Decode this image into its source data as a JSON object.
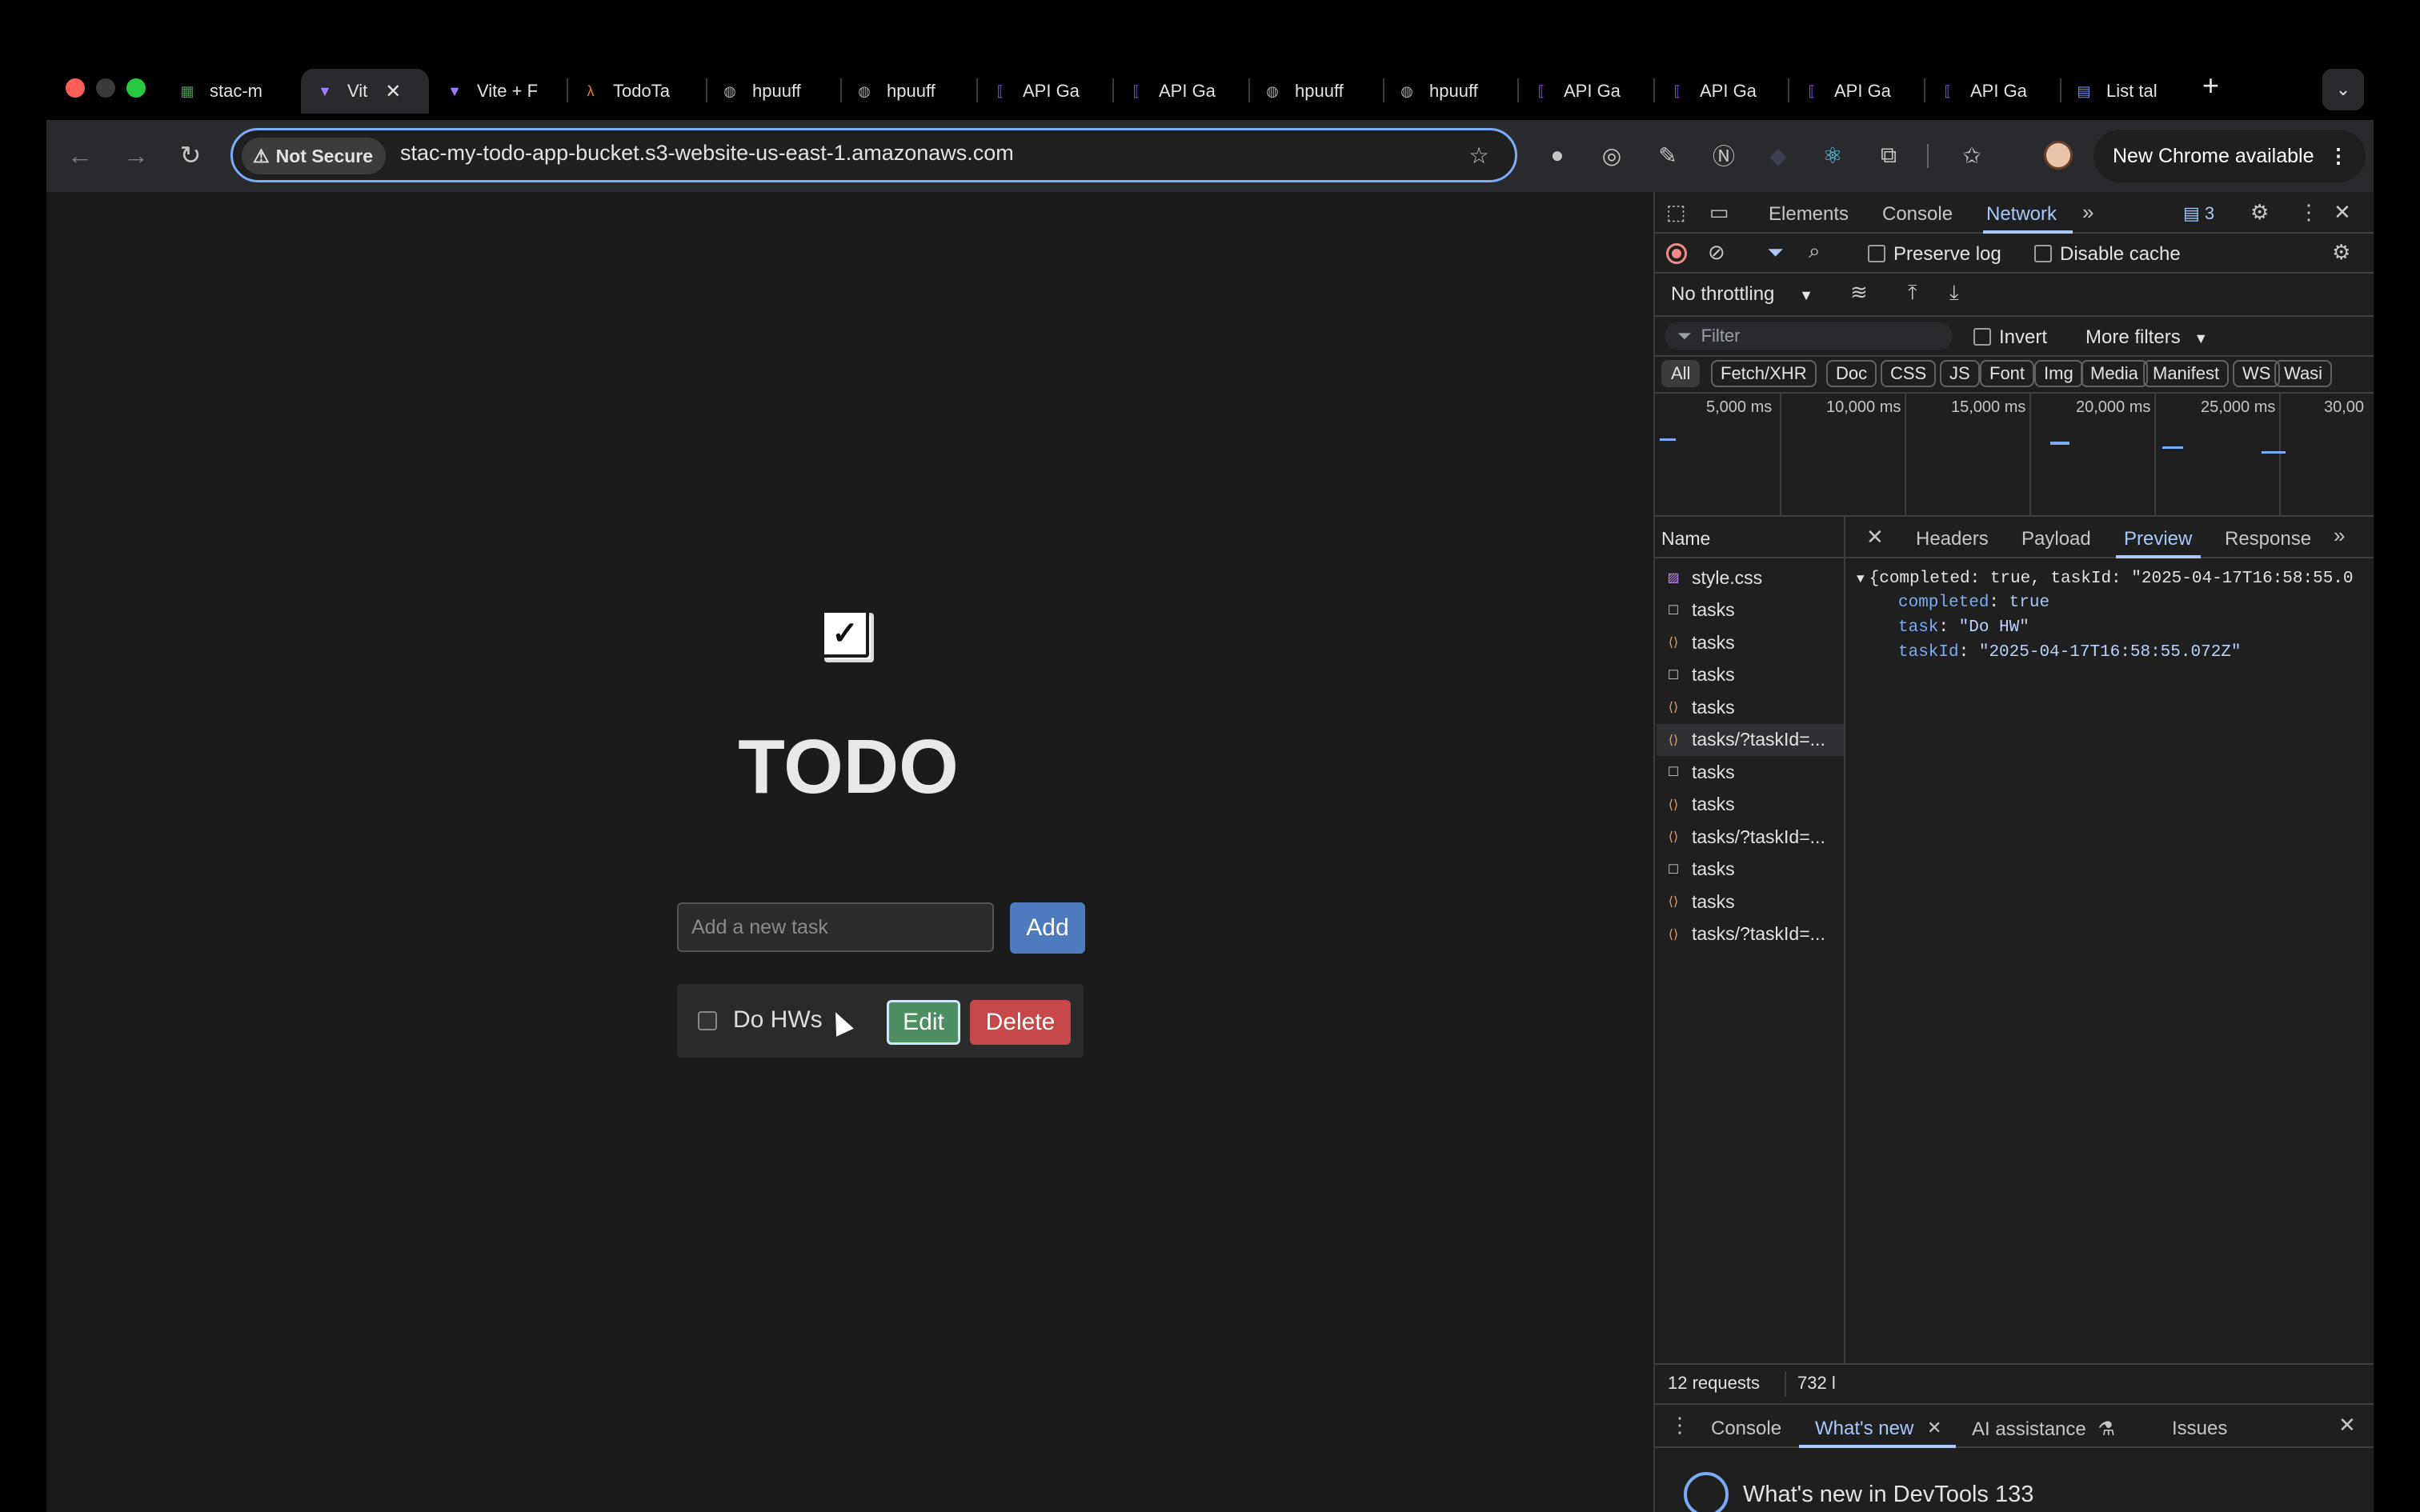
{
  "window": {
    "traffic_lights": [
      "#ff5f57",
      "#3a3a3a",
      "#28c840"
    ]
  },
  "tabs": [
    {
      "label": "stac-m",
      "icon": "sheet-icon",
      "icon_color": "#4c9a52"
    },
    {
      "label": "Vit",
      "icon": "vite-icon",
      "icon_color": "#9d7cff",
      "active": true
    },
    {
      "label": "Vite + F",
      "icon": "vite-icon",
      "icon_color": "#9d7cff"
    },
    {
      "label": "TodoTa",
      "icon": "aws-lambda-icon",
      "icon_color": "#e8841b"
    },
    {
      "label": "hpuuff",
      "icon": "globe-icon",
      "icon_color": "#aaaaaa"
    },
    {
      "label": "hpuuff",
      "icon": "globe-icon",
      "icon_color": "#aaaaaa"
    },
    {
      "label": "API Ga",
      "icon": "api-gateway-icon",
      "icon_color": "#8c4fff"
    },
    {
      "label": "API Ga",
      "icon": "api-gateway-icon",
      "icon_color": "#8c4fff"
    },
    {
      "label": "hpuuff",
      "icon": "globe-icon",
      "icon_color": "#aaaaaa"
    },
    {
      "label": "hpuuff",
      "icon": "globe-icon",
      "icon_color": "#aaaaaa"
    },
    {
      "label": "API Ga",
      "icon": "api-gateway-icon",
      "icon_color": "#8c4fff"
    },
    {
      "label": "API Ga",
      "icon": "api-gateway-icon",
      "icon_color": "#8c4fff"
    },
    {
      "label": "API Ga",
      "icon": "api-gateway-icon",
      "icon_color": "#8c4fff"
    },
    {
      "label": "API Ga",
      "icon": "api-gateway-icon",
      "icon_color": "#8c4fff"
    },
    {
      "label": "List tal",
      "icon": "docs-icon",
      "icon_color": "#6b8cff"
    }
  ],
  "toolbar": {
    "not_secure": "Not Secure",
    "url": "stac-my-todo-app-bucket.s3-website-us-east-1.amazonaws.com",
    "new_chrome": "New Chrome available"
  },
  "app": {
    "title": "TODO",
    "input_placeholder": "Add a new task",
    "add_label": "Add",
    "task": {
      "text": "Do HWs",
      "completed": false
    },
    "edit_label": "Edit",
    "delete_label": "Delete"
  },
  "devtools": {
    "tabs": [
      "Elements",
      "Console",
      "Network"
    ],
    "active_tab": "Network",
    "issues_count": "3",
    "preserve_log": "Preserve log",
    "disable_cache": "Disable cache",
    "throttling": "No throttling",
    "filter_placeholder": "Filter",
    "invert": "Invert",
    "more_filters": "More filters",
    "type_filters": [
      "All",
      "Fetch/XHR",
      "Doc",
      "CSS",
      "JS",
      "Font",
      "Img",
      "Media",
      "Manifest",
      "WS",
      "Wasi"
    ],
    "timeline_labels": [
      "5,000 ms",
      "10,000 ms",
      "15,000 ms",
      "20,000 ms",
      "25,000 ms",
      "30,00"
    ],
    "name_header": "Name",
    "requests": [
      {
        "name": "style.css",
        "kind": "css"
      },
      {
        "name": "tasks",
        "kind": "doc"
      },
      {
        "name": "tasks",
        "kind": "xhr"
      },
      {
        "name": "tasks",
        "kind": "doc"
      },
      {
        "name": "tasks",
        "kind": "xhr"
      },
      {
        "name": "tasks/?taskId=...",
        "kind": "xhr",
        "selected": true
      },
      {
        "name": "tasks",
        "kind": "doc"
      },
      {
        "name": "tasks",
        "kind": "xhr"
      },
      {
        "name": "tasks/?taskId=...",
        "kind": "xhr"
      },
      {
        "name": "tasks",
        "kind": "doc"
      },
      {
        "name": "tasks",
        "kind": "xhr"
      },
      {
        "name": "tasks/?taskId=...",
        "kind": "xhr"
      }
    ],
    "detail_tabs": [
      "Headers",
      "Payload",
      "Preview",
      "Response"
    ],
    "active_detail_tab": "Preview",
    "preview": {
      "summary": "{completed: true, taskId: \"2025-04-17T16:58:55.0",
      "fields": [
        {
          "key": "completed",
          "value": "true"
        },
        {
          "key": "task",
          "value": "\"Do HW\""
        },
        {
          "key": "taskId",
          "value": "\"2025-04-17T16:58:55.072Z\""
        }
      ]
    },
    "status_requests": "12 requests",
    "status_size": "732 l",
    "drawer_tabs": [
      "Console",
      "What's new",
      "AI assistance",
      "Issues"
    ],
    "active_drawer_tab": "What's new",
    "whats_new": "What's new in DevTools 133"
  }
}
